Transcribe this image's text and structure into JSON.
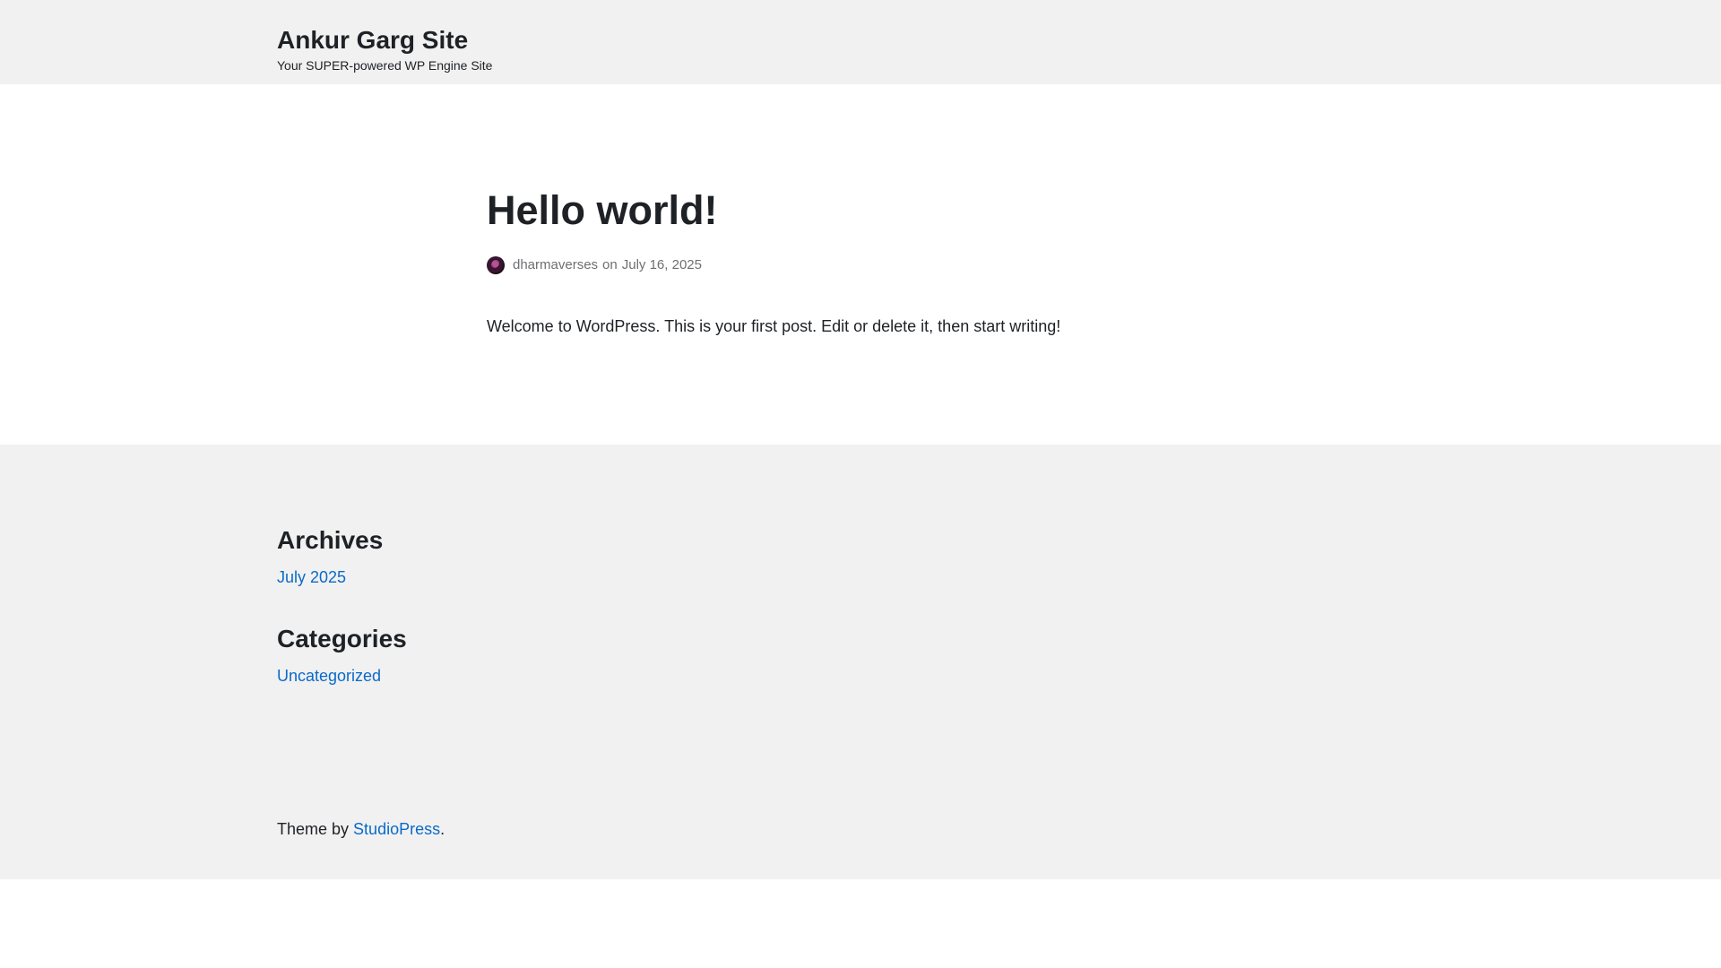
{
  "header": {
    "site_title": "Ankur Garg Site",
    "tagline": "Your SUPER-powered WP Engine Site"
  },
  "post": {
    "title": "Hello world!",
    "author": "dharmaverses",
    "meta_separator": "on",
    "date": "July 16, 2025",
    "content": "Welcome to WordPress. This is your first post. Edit or delete it, then start writing!"
  },
  "widgets": {
    "archives": {
      "title": "Archives",
      "links": [
        "July 2025"
      ]
    },
    "categories": {
      "title": "Categories",
      "links": [
        "Uncategorized"
      ]
    }
  },
  "footer": {
    "credit_prefix": "Theme by ",
    "credit_link": "StudioPress",
    "credit_suffix": "."
  },
  "colors": {
    "header_bg": "#f1f1f1",
    "link": "#0b6ac9",
    "text": "#1e2125",
    "meta": "#6e6f72"
  }
}
